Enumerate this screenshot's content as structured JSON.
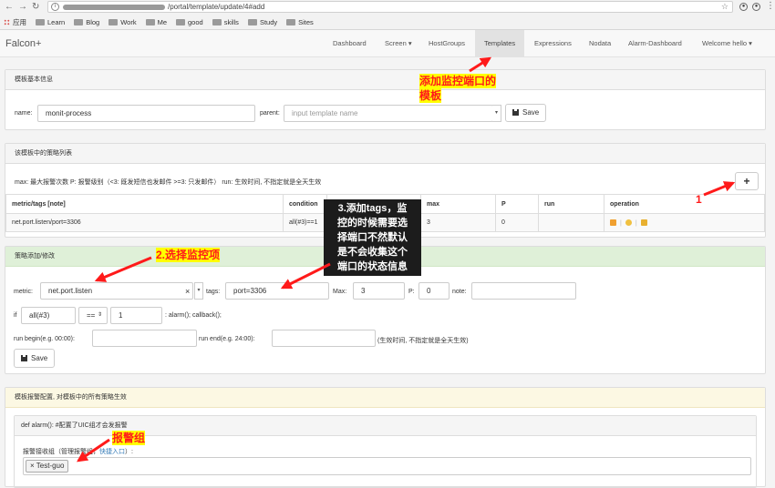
{
  "browser": {
    "url_path": "/portal/template/update/4#add",
    "bookmarks": [
      "应用",
      "Learn",
      "Blog",
      "Work",
      "Me",
      "good",
      "skills",
      "Study",
      "Sites"
    ]
  },
  "navbar": {
    "brand": "Falcon+",
    "items": [
      "Dashboard",
      "Screen ▾",
      "HostGroups",
      "Templates",
      "Expressions",
      "Nodata",
      "Alarm-Dashboard",
      "Welcome hello ▾"
    ],
    "active": "Templates"
  },
  "template_info": {
    "header": "模板基本信息",
    "name_label": "name:",
    "name_value": "monit-process",
    "parent_label": "parent:",
    "parent_placeholder": "input template name",
    "save_label": "Save"
  },
  "strategy_list": {
    "header": "该模板中的策略列表",
    "hint": "max: 最大报警次数 P: 报警级别（<3: 既发短信也发邮件 >=3: 只发邮件） run: 生效时间, 不指定就是全天生效",
    "add_label": "+",
    "columns": [
      "metric/tags [note]",
      "condition",
      "",
      "max",
      "P",
      "run",
      "operation"
    ],
    "rows": [
      {
        "metric": "net.port.listen/port=3306",
        "condition": "all(#3)==1",
        "max": "3",
        "p": "0",
        "run": ""
      }
    ]
  },
  "strategy_edit": {
    "header": "策略添加/修改",
    "metric_label": "metric:",
    "metric_value": "net.port.listen",
    "metric_clear": "×",
    "metric_caret": "▾",
    "tags_label": "tags:",
    "tags_value": "port=3306",
    "max_label": "Max:",
    "max_value": "3",
    "p_label": "P:",
    "p_value": "0",
    "note_label": "note:",
    "note_value": "",
    "if_label": "if",
    "func_value": "all(#3)",
    "op_value": "==",
    "right_value": "1",
    "callback_text": ": alarm(); callback();",
    "run_begin_label": "run begin(e.g. 00:00):",
    "run_end_label": "run end(e.g. 24:00):",
    "run_hint": "(生效时间, 不指定就是全天生效)",
    "save_label": "Save"
  },
  "alarm_config": {
    "header": "模板报警配置, 对模板中的所有策略生效",
    "def_label": "def alarm(): #配置了UIC组才会发报警",
    "receiver_label": "报警接收组（管理报警组，",
    "receiver_link": "快捷入口",
    "receiver_label_end": "）:",
    "tag_value": "× Test-guo"
  },
  "annotations": {
    "a_template": "添加监控端口的",
    "a_template2": "模板",
    "a_one": "1",
    "a_two": "2.选择监控项",
    "a_three_lines": [
      "3.添加tags，监",
      "控的时候需要选",
      "择端口不然默认",
      "是不会收集这个",
      "端口的状态信息"
    ],
    "a_group": "报警组"
  },
  "colors": {
    "annotation": "#ff1a1a",
    "highlight": "#ffff00",
    "green_head": "#dff0d8",
    "yellow_head": "#fcf8e3"
  }
}
